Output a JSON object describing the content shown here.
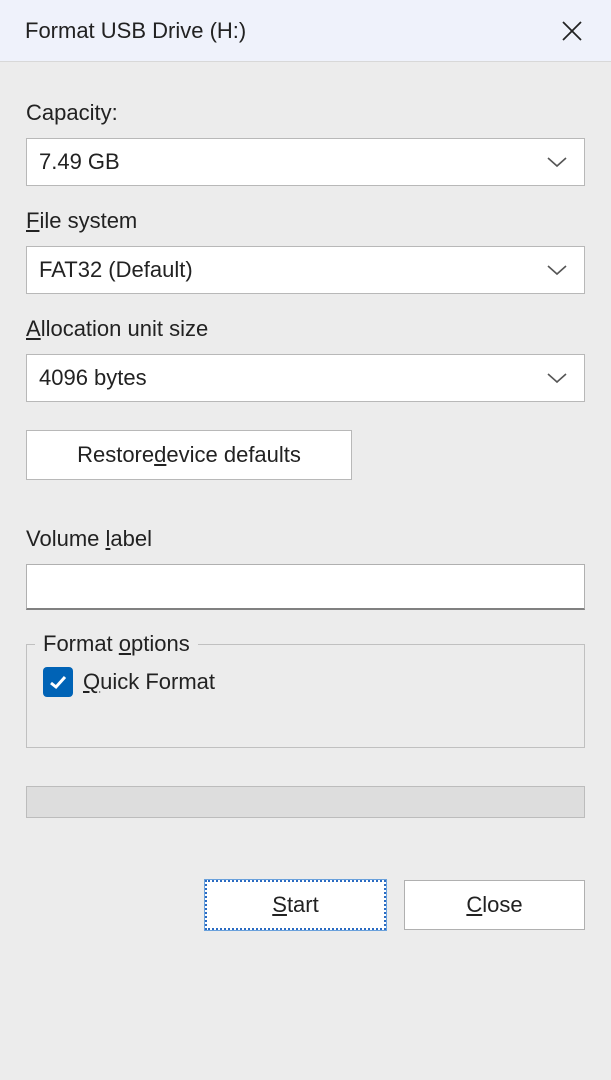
{
  "titlebar": {
    "title": "Format USB Drive (H:)"
  },
  "labels": {
    "capacity": "Capacity:",
    "filesystem_pre": "",
    "filesystem_u": "F",
    "filesystem_post": "ile system",
    "allocation_pre": "",
    "allocation_u": "A",
    "allocation_post": "llocation unit size",
    "volume_pre": "Volume ",
    "volume_u": "l",
    "volume_post": "abel",
    "formatoptions_pre": "Format ",
    "formatoptions_u": "o",
    "formatoptions_post": "ptions"
  },
  "dropdowns": {
    "capacity_value": "7.49 GB",
    "filesystem_value": "FAT32 (Default)",
    "allocation_value": "4096 bytes"
  },
  "buttons": {
    "restore_pre": "Restore ",
    "restore_u": "d",
    "restore_post": "evice defaults",
    "start_pre": "",
    "start_u": "S",
    "start_post": "tart",
    "close_pre": "",
    "close_u": "C",
    "close_post": "lose"
  },
  "checkbox": {
    "quickformat_pre": "",
    "quickformat_u": "Q",
    "quickformat_post": "uick Format"
  },
  "inputs": {
    "volume_value": ""
  }
}
